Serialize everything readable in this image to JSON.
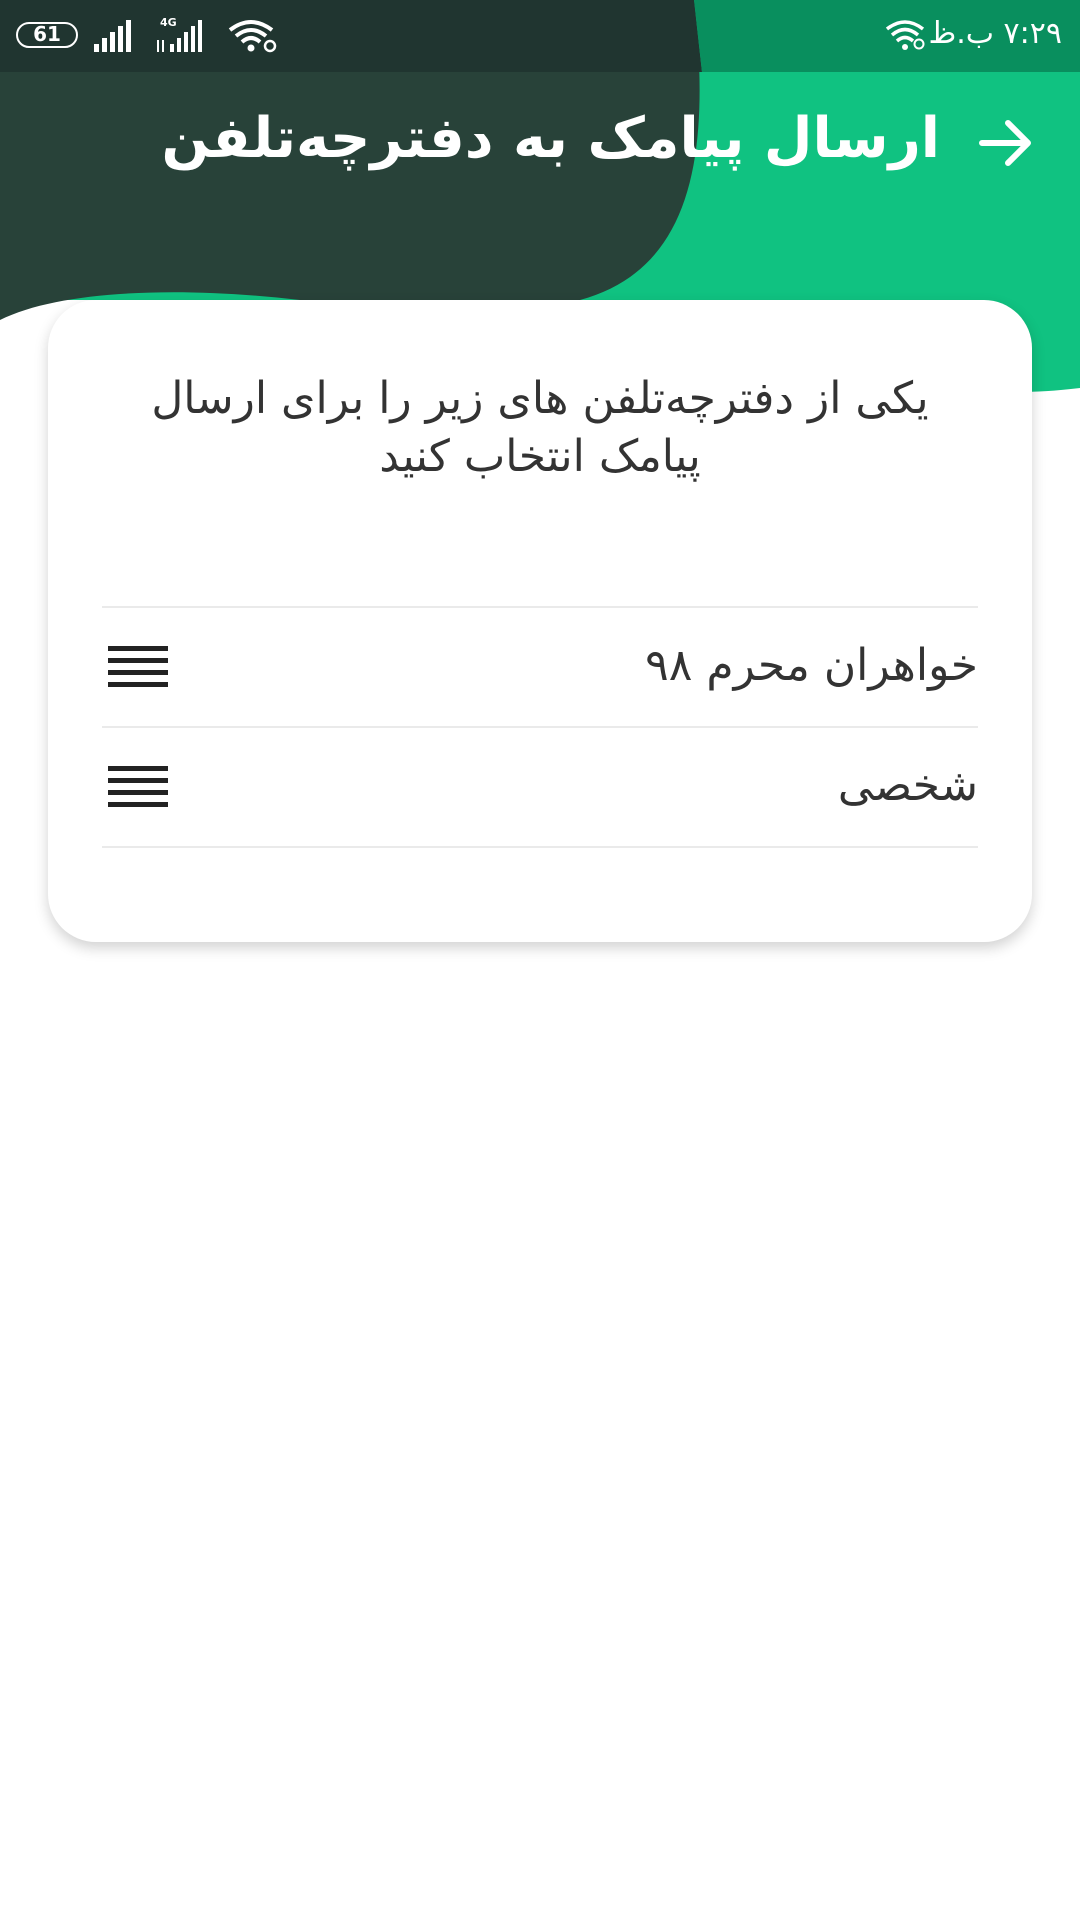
{
  "status_bar": {
    "time": "۷:۲۹ ب.ظ",
    "battery": "61",
    "network_type": "4G",
    "icons": [
      "battery-icon",
      "signal-icon",
      "signal-4g-icon",
      "wifi-icon"
    ]
  },
  "header": {
    "title": "ارسال پیامک به دفترچه‌تلفن",
    "back_icon": "arrow-right-icon"
  },
  "card": {
    "prompt": "یکی از دفترچه‌تلفن های زیر را برای ارسال پیامک انتخاب کنید",
    "items": [
      {
        "label": "خواهران محرم ۹۸",
        "icon": "menu-icon"
      },
      {
        "label": "شخصی",
        "icon": "menu-icon"
      }
    ]
  },
  "colors": {
    "dark_green": "#284239",
    "bright_green": "#10c281",
    "status_green": "#098f5e",
    "text": "#333333",
    "divider": "#eaeaea"
  }
}
